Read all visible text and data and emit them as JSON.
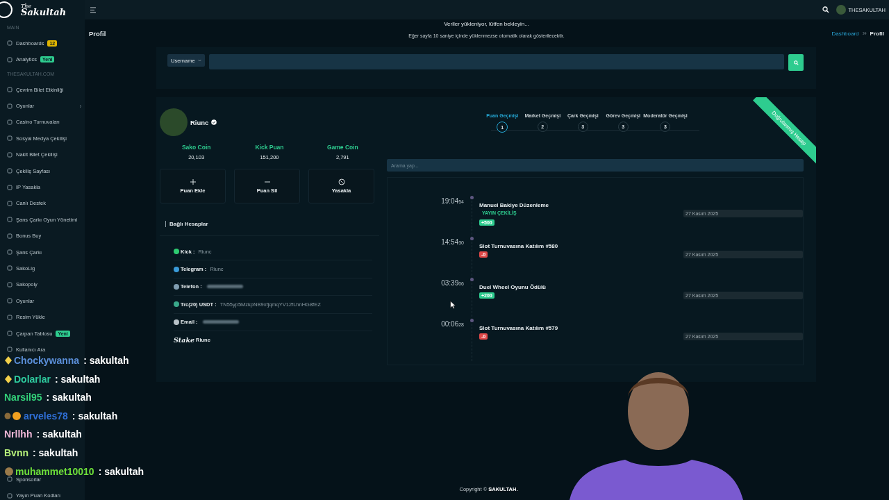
{
  "sidebar": {
    "logo_small": "The",
    "logo": "Sakultah",
    "sections": [
      {
        "label": "MAIN",
        "items": [
          {
            "label": "Dashboards",
            "badge": {
              "text": "12",
              "color": "#e0b400"
            },
            "expandable": false
          },
          {
            "label": "Analytics",
            "badge": {
              "text": "Yeni",
              "color": "#2ecc8f"
            },
            "expandable": false
          }
        ]
      },
      {
        "label": "THESAKULTAH.COM",
        "items": [
          {
            "label": "Çevrim Bilet Etkinliği",
            "expandable": false
          },
          {
            "label": "Oyunlar",
            "expandable": true
          },
          {
            "label": "Casino Turnuvaları",
            "expandable": false
          },
          {
            "label": "Sosyal Medya Çekilişi",
            "expandable": false
          },
          {
            "label": "Nakit Bilet Çekilişi",
            "expandable": false
          },
          {
            "label": "Çekiliş Sayfası",
            "expandable": false
          },
          {
            "label": "IP Yasakla",
            "expandable": false
          },
          {
            "label": "Canlı Destek",
            "expandable": false
          },
          {
            "label": "Şans Çarkı Oyun Yönetimi",
            "expandable": false
          },
          {
            "label": "Bonus Buy",
            "expandable": false
          },
          {
            "label": "Şans Çarkı",
            "expandable": false
          },
          {
            "label": "SakoLig",
            "expandable": false
          },
          {
            "label": "Sakopoly",
            "expandable": false
          },
          {
            "label": "Oyunlar",
            "expandable": false
          },
          {
            "label": "Resim Yükle",
            "expandable": false
          },
          {
            "label": "Çarpan Tablosu",
            "badge": {
              "text": "Yeni",
              "color": "#2ecc8f"
            },
            "expandable": false
          },
          {
            "label": "Kullanıcı Ara",
            "expandable": false
          }
        ]
      }
    ],
    "lower_items": [
      {
        "label": "Sponsorlar",
        "expandable": false
      },
      {
        "label": "Yayın Puan Kodları",
        "expandable": false
      }
    ]
  },
  "topbar": {
    "user": "THESAKULTAH"
  },
  "header": {
    "title": "Profil",
    "loading": "Veriler yükleniyor, lütfen bekleyin...",
    "loading_hint": "Eğer sayfa 10 saniye içinde yüklenmezse otomatik olarak gösterilecektir.",
    "breadcrumb": [
      {
        "label": "Dashboard",
        "link": true
      },
      {
        "label": "Profil",
        "link": false
      }
    ]
  },
  "search": {
    "select": "Username"
  },
  "profile": {
    "name": "Riunc",
    "verified": true,
    "ribbon": "Doğrulanmış Hesap",
    "stats": [
      {
        "label": "Sako Coin",
        "value": "20,103"
      },
      {
        "label": "Kick Puan",
        "value": "151,200"
      },
      {
        "label": "Game Coin",
        "value": "2,791"
      }
    ],
    "actions": [
      {
        "label": "Puan Ekle",
        "kind": "add"
      },
      {
        "label": "Puan Sil",
        "kind": "remove"
      },
      {
        "label": "Yasakla",
        "kind": "ban"
      }
    ],
    "accounts_title": "Bağlı Hesaplar",
    "accounts": [
      {
        "kind": "icon",
        "label": "Kick :",
        "value": "Riunc",
        "color": "#2ecc71"
      },
      {
        "kind": "icon",
        "label": "Telegram :",
        "value": "Riunc",
        "color": "#3a9bd9"
      },
      {
        "kind": "blurred",
        "label": "Telefon :",
        "color": "#7f9db0"
      },
      {
        "kind": "icon",
        "label": "Trc(20) USDT :",
        "value": "TN55yp5MzkpNB9xfjqmqYV12fLhnHG8fEZ",
        "color": "#3aa88a"
      },
      {
        "kind": "blurred",
        "label": "Email :",
        "color": "#b8c2c8"
      },
      {
        "kind": "logo",
        "label": "Stake",
        "value": "Riunc"
      }
    ]
  },
  "history": {
    "steps": [
      {
        "label": "Puan Geçmişi",
        "number": "1",
        "selected": true
      },
      {
        "label": "Market Geçmişi",
        "number": "2",
        "selected": false
      },
      {
        "label": "Çark Geçmişi",
        "number": "3",
        "selected": false
      },
      {
        "label": "Görev Geçmişi",
        "number": "3",
        "selected": false
      },
      {
        "label": "Moderatör Geçmişi",
        "number": "3",
        "selected": false
      }
    ],
    "search_placeholder": "Arama yap...",
    "entries": [
      {
        "time": "19:04",
        "seconds": "54",
        "title": "Manuel Bakiye Düzenleme",
        "tag": "YAYIN ÇEKİLİŞ",
        "amount": "+500",
        "kind": "positive",
        "date": "27 Kasım 2025"
      },
      {
        "time": "14:54",
        "seconds": "30",
        "title": "Slot Turnuvasına Katılım #580",
        "amount": "-0",
        "kind": "negative",
        "date": "27 Kasım 2025"
      },
      {
        "time": "03:39",
        "seconds": "06",
        "title": "Duel Wheel Oyunu Ödülü",
        "amount": "+200",
        "kind": "positive",
        "date": "27 Kasım 2025"
      },
      {
        "time": "00:06",
        "seconds": "28",
        "title": "Slot Turnuvasına Katılım #579",
        "amount": "-0",
        "kind": "negative",
        "date": "27 Kasım 2025"
      }
    ]
  },
  "footer": "Copyright © **SAKULTAH.**",
  "chat": [
    {
      "user": "Chockywanna",
      "message": ": sakultah",
      "color": "#5b8fd9",
      "kind": "diamond"
    },
    {
      "user": "Dolarlar",
      "message": ": sakultah",
      "color": "#2ecc9f",
      "kind": "diamond"
    },
    {
      "user": "Narsil95",
      "message": ": sakultah",
      "color": "#33d17a",
      "kind": "plain"
    },
    {
      "user": "arveles78",
      "message": ": sakultah",
      "color": "#2f6fd6",
      "kind": "medal"
    },
    {
      "user": "Nrllhh",
      "message": ": sakultah",
      "color": "#f0b8d8",
      "kind": "plain"
    },
    {
      "user": "Bvnn",
      "message": ": sakultah",
      "color": "#b6f07a",
      "kind": "plain"
    },
    {
      "user": "muhammet10010",
      "message": ": sakultah",
      "color": "#6fe03a",
      "kind": "sticker"
    }
  ]
}
